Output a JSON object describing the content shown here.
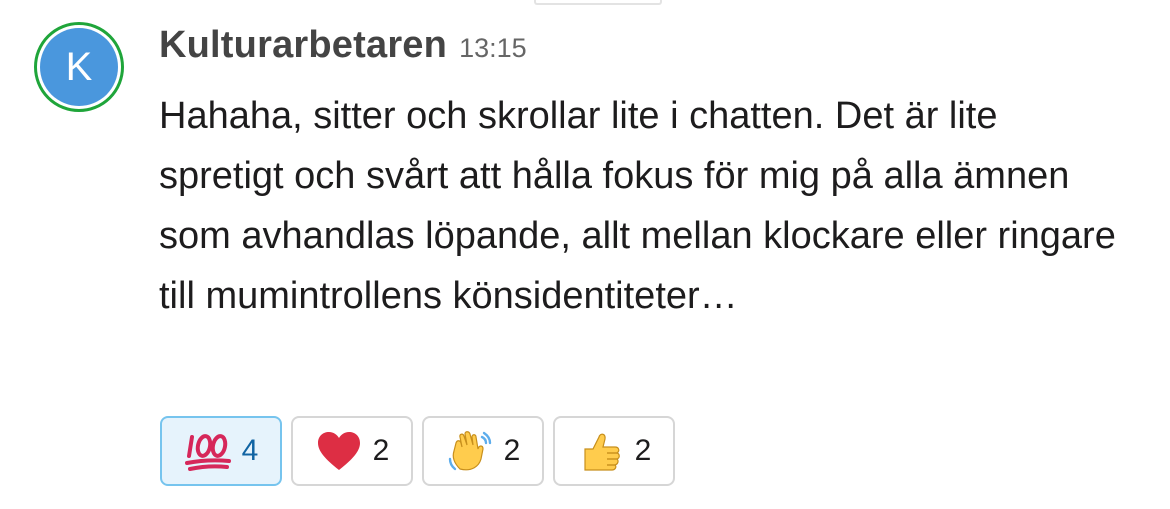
{
  "message": {
    "avatar_letter": "K",
    "username": "Kulturarbetaren",
    "timestamp": "13:15",
    "text": "Hahaha, sitter och skrollar lite i chatten. Det är lite spretigt och svårt att hålla fokus för mig på alla ämnen som avhandlas löpande, allt mellan klockare eller ringare till mumintrollens könsidentiteter…"
  },
  "reactions": [
    {
      "emoji": "hundred-points",
      "count": "4",
      "selected": true
    },
    {
      "emoji": "red-heart",
      "count": "2",
      "selected": false
    },
    {
      "emoji": "waving-hand",
      "count": "2",
      "selected": false
    },
    {
      "emoji": "thumbs-up",
      "count": "2",
      "selected": false
    }
  ],
  "colors": {
    "avatar_bg": "#4a97dd",
    "presence_ring": "#1fa53a",
    "selected_reaction_bg": "#e6f3fc",
    "selected_reaction_border": "#76c4ee",
    "selected_count": "#1164a3"
  }
}
